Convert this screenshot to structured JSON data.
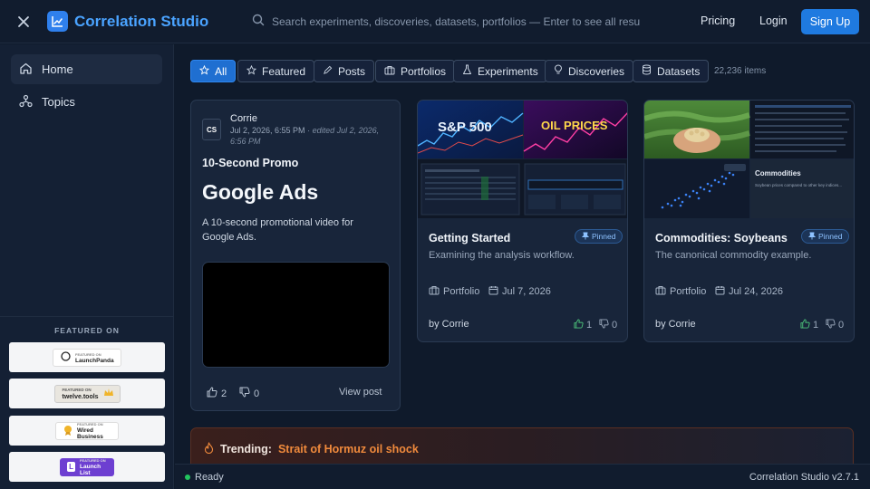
{
  "header": {
    "brand_name": "Correlation Studio",
    "search_placeholder": "Search experiments, discoveries, datasets, portfolios — Enter to see all resu",
    "pricing": "Pricing",
    "login": "Login",
    "signup": "Sign Up"
  },
  "sidebar": {
    "items": [
      {
        "label": "Home",
        "icon": "home-icon",
        "active": true
      },
      {
        "label": "Topics",
        "icon": "topics-icon",
        "active": false
      }
    ],
    "featured_title": "FEATURED ON",
    "badges": [
      {
        "small": "FEATURED ON",
        "name": "LaunchPanda"
      },
      {
        "small": "FEATURED ON",
        "name": "twelve.tools"
      },
      {
        "small": "FEATURED ON",
        "name": "Wired Business"
      },
      {
        "small": "FEATURED ON",
        "name": "Launch List"
      }
    ]
  },
  "filters": {
    "items": [
      "All",
      "Featured",
      "Posts",
      "Portfolios",
      "Experiments",
      "Discoveries",
      "Datasets"
    ],
    "active": "All",
    "count": "22,236 items"
  },
  "post": {
    "author": "Corrie",
    "avatar_text": "CS",
    "date": "Jul 2, 2026, 6:55 PM",
    "edited": "· edited Jul 2, 2026, 6:56 PM",
    "kicker": "10-Second Promo",
    "title": "Google Ads",
    "description": "A 10-second promotional video for Google Ads.",
    "likes": "2",
    "dislikes": "0",
    "view_label": "View post"
  },
  "portfolios": [
    {
      "title": "Getting Started",
      "pinned": "Pinned",
      "subtitle": "Examining the analysis workflow.",
      "type": "Portfolio",
      "date": "Jul 7, 2026",
      "by": "by Corrie",
      "likes": "1",
      "dislikes": "0",
      "thumb_text_1": "S&P 500",
      "thumb_text_2": "OIL PRICES"
    },
    {
      "title": "Commodities: Soybeans",
      "pinned": "Pinned",
      "subtitle": "The canonical commodity example.",
      "type": "Portfolio",
      "date": "Jul 24, 2026",
      "by": "by Corrie",
      "likes": "1",
      "dislikes": "0",
      "thumb_text_1": "Commodities",
      "thumb_text_2": "Soybean prices compared to other key indices..."
    }
  ],
  "trending": {
    "label": "Trending:",
    "topic": "Strait of Hormuz oil shock"
  },
  "status": {
    "text": "Ready",
    "version": "Correlation Studio v2.7.1"
  },
  "colors": {
    "accent": "#1f7ae0",
    "background": "#0f1a2b",
    "trending": "#f08a3c",
    "status_ok": "#22c55e"
  }
}
